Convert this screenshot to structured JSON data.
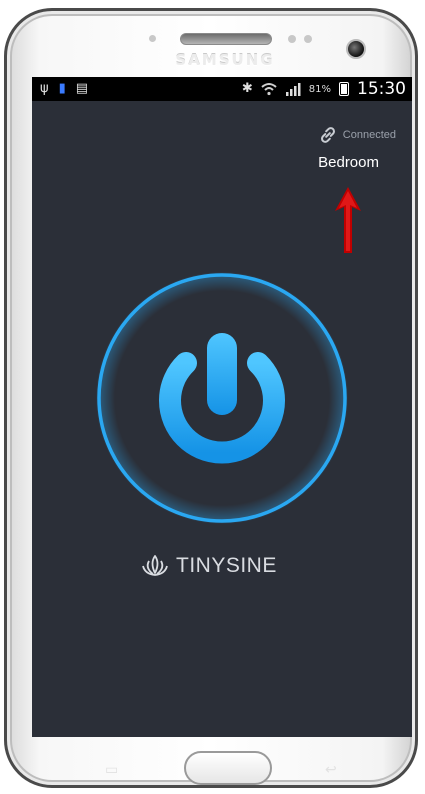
{
  "device": {
    "brand": "SAMSUNG"
  },
  "statusbar": {
    "left_icons": [
      "usb-icon",
      "phone-icon",
      "sd-card-icon"
    ],
    "right_icons": [
      "bluetooth-icon",
      "wifi-icon",
      "signal-icon",
      "battery-icon"
    ],
    "battery_percent": "81%",
    "time": "15:30"
  },
  "app": {
    "connection_status": "Connected",
    "device_name": "Bedroom",
    "logo_text": "TINYSINE",
    "icons": {
      "connection": "link-icon",
      "power": "power-icon",
      "logo": "lotus-icon"
    },
    "colors": {
      "background": "#2b2f38",
      "accent": "#2aa8f2",
      "annotation_arrow": "#c00000"
    }
  }
}
